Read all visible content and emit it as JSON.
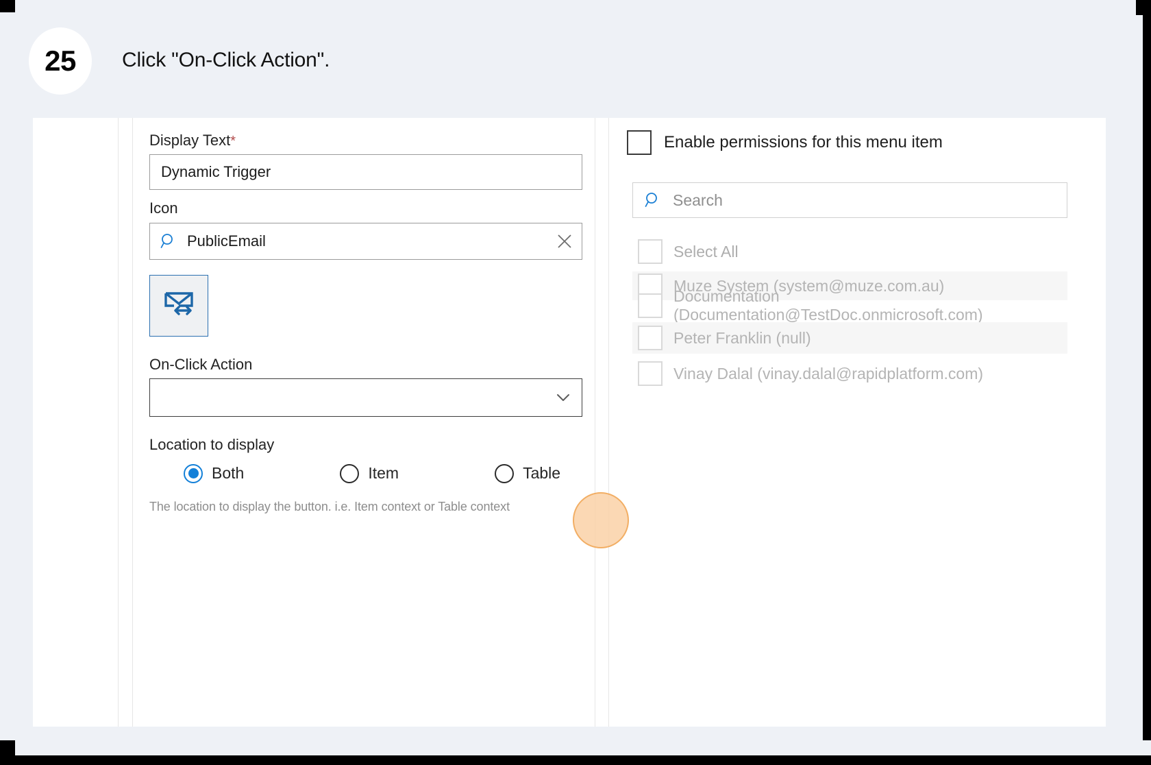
{
  "step": {
    "number": "25",
    "instruction": "Click \"On-Click Action\"."
  },
  "form": {
    "display_text": {
      "label": "Display Text",
      "required_marker": "*",
      "value": "Dynamic Trigger"
    },
    "icon": {
      "label": "Icon",
      "value": "PublicEmail",
      "search_icon": "search-icon",
      "clear_icon": "close-icon",
      "preview_icon": "mail-forward-icon"
    },
    "on_click_action": {
      "label": "On-Click Action",
      "value": "",
      "chevron_icon": "chevron-down-icon"
    },
    "location_to_display": {
      "label": "Location to display",
      "options": [
        {
          "label": "Both",
          "selected": true
        },
        {
          "label": "Item",
          "selected": false
        },
        {
          "label": "Table",
          "selected": false
        }
      ],
      "helper_text": "The location to display the button. i.e. Item context or Table context"
    }
  },
  "permissions": {
    "enable_label": "Enable permissions for this menu item",
    "enable_checked": false,
    "search": {
      "placeholder": "Search",
      "value": "",
      "icon": "search-icon"
    },
    "select_all_label": "Select All",
    "users": [
      {
        "label": "Muze System (system@muze.com.au)",
        "checked": false
      },
      {
        "label": "Documentation (Documentation@TestDoc.onmicrosoft.com)",
        "checked": false
      },
      {
        "label": "Peter Franklin (null)",
        "checked": false
      },
      {
        "label": "Vinay Dalal (vinay.dalal@rapidplatform.com)",
        "checked": false
      }
    ]
  },
  "colors": {
    "page_background": "#eef1f6",
    "accent_blue": "#1380d8",
    "icon_blue": "#2a6fb0",
    "highlight_fill": "#fbd2a7",
    "highlight_border": "#f0a04a",
    "required_star": "#b14a4a"
  }
}
